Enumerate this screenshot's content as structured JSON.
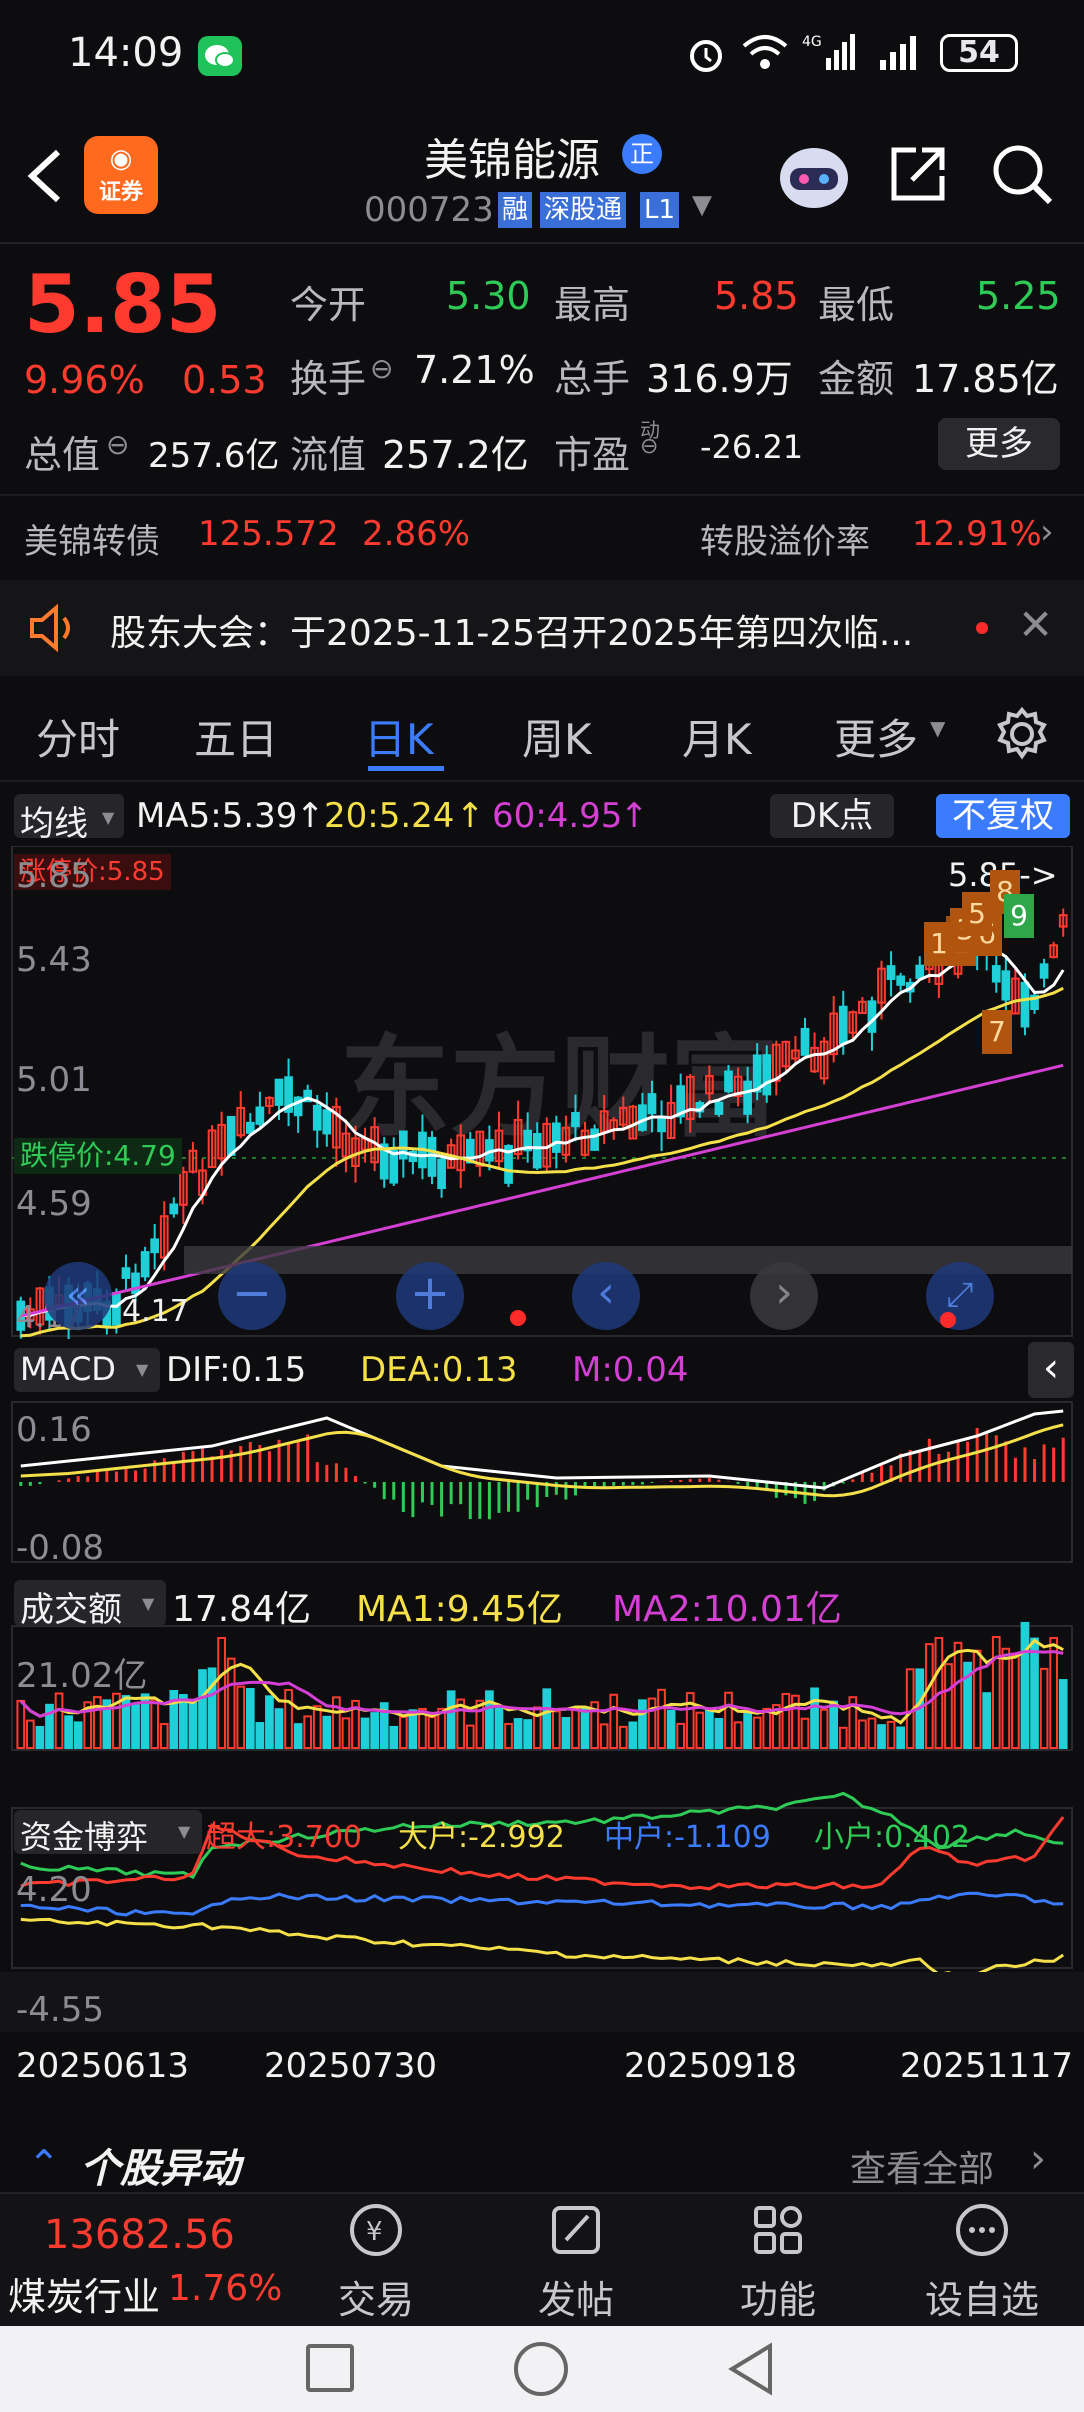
{
  "status": {
    "time": "14:09",
    "battery": "54"
  },
  "header": {
    "title": "美锦能源",
    "badge": "正",
    "code": "000723",
    "tags": [
      "融",
      "深股通",
      "L1"
    ]
  },
  "quote": {
    "price": "5.85",
    "pct": "9.96%",
    "change": "0.53",
    "open_label": "今开",
    "open": "5.30",
    "high_label": "最高",
    "high": "5.85",
    "low_label": "最低",
    "low": "5.25",
    "turnover_label": "换手",
    "turnover": "7.21%",
    "volume_label": "总手",
    "volume": "316.9万",
    "amount_label": "金额",
    "amount": "17.85亿",
    "mktcap_label": "总值",
    "mktcap": "257.6亿",
    "float_label": "流值",
    "float": "257.2亿",
    "pe_label": "市盈",
    "pe_sup": "动",
    "pe": "-26.21",
    "more": "更多"
  },
  "bond": {
    "name": "美锦转债",
    "price": "125.572",
    "pct": "2.86%",
    "premium_label": "转股溢价率",
    "premium": "12.91%"
  },
  "notice": {
    "text": "股东大会：于2025-11-25召开2025年第四次临..."
  },
  "tabs": [
    {
      "label": "分时"
    },
    {
      "label": "五日"
    },
    {
      "label": "日K"
    },
    {
      "label": "周K"
    },
    {
      "label": "月K"
    },
    {
      "label": "更多"
    }
  ],
  "kline": {
    "ma_selector": "均线",
    "ma5": "MA5:5.39",
    "ma20": "20:5.24",
    "ma60": "60:4.95",
    "dk": "DK点",
    "fuquan": "不复权",
    "limit_up": "涨停价:5.85",
    "limit_down": "跌停价:4.79",
    "y_labels": [
      "5.85",
      "5.43",
      "5.01",
      "4.59",
      "4.17"
    ],
    "last_marker": "5.85->",
    "low_marker": "4.17",
    "tags": [
      "1",
      "2",
      "4",
      "3",
      "6",
      "5",
      "8",
      "9",
      "7"
    ],
    "watermark": "东方财富"
  },
  "macd": {
    "selector": "MACD",
    "dif": "DIF:0.15",
    "dea": "DEA:0.13",
    "m": "M:0.04",
    "y_top": "0.16",
    "y_bottom": "-0.08"
  },
  "volume": {
    "selector": "成交额",
    "current": "17.84亿",
    "ma1": "MA1:9.45亿",
    "ma2": "MA2:10.01亿",
    "y_top": "21.02亿"
  },
  "capital": {
    "selector": "资金博弈",
    "super": "超大:3.700",
    "large": "大户:-2.992",
    "medium": "中户:-1.109",
    "small": "小户:0.402",
    "y_top": "4.20",
    "y_bottom": "-4.55"
  },
  "dates": [
    "20250613",
    "20250730",
    "20250918",
    "20251117"
  ],
  "movement": {
    "title": "个股异动",
    "more": "查看全部"
  },
  "bottom": {
    "index_value": "13682.56",
    "index_name": "煤炭行业",
    "index_pct": "1.76%",
    "buttons": [
      "交易",
      "发帖",
      "功能",
      "设自选"
    ]
  },
  "colors": {
    "up": "#ff3b30",
    "down": "#2fcb57",
    "accent": "#3b7cff",
    "ma5": "#ffffff",
    "ma20": "#f5e04a",
    "ma60": "#d43fd4"
  }
}
